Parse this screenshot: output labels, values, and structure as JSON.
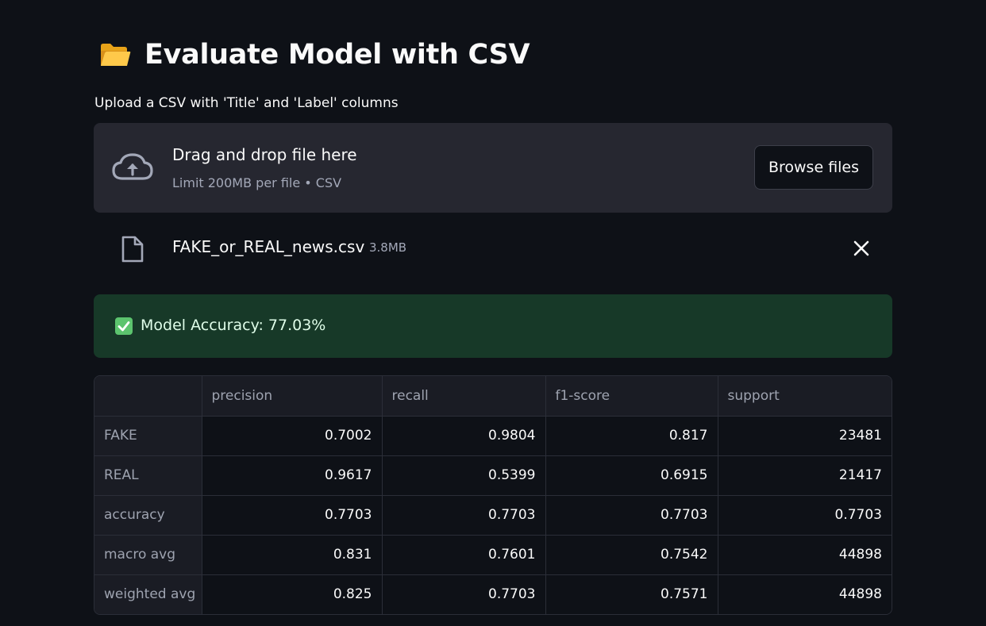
{
  "header": {
    "icon": "open-folder-icon",
    "title": "Evaluate Model with CSV"
  },
  "uploader": {
    "label": "Upload a CSV with 'Title' and 'Label' columns",
    "icon": "cloud-upload-icon",
    "drop_title": "Drag and drop file here",
    "drop_subtitle": "Limit 200MB per file • CSV",
    "browse_label": "Browse files"
  },
  "uploaded_file": {
    "icon": "file-icon",
    "name": "FAKE_or_REAL_news.csv",
    "size": "3.8MB",
    "remove_icon": "close-icon"
  },
  "result": {
    "icon": "check-mark-icon",
    "message": "Model Accuracy: 77.03%",
    "color": "#173928"
  },
  "report": {
    "columns": [
      "",
      "precision",
      "recall",
      "f1-score",
      "support"
    ],
    "rows": [
      {
        "label": "FAKE",
        "precision": "0.7002",
        "recall": "0.9804",
        "f1": "0.817",
        "support": "23481"
      },
      {
        "label": "REAL",
        "precision": "0.9617",
        "recall": "0.5399",
        "f1": "0.6915",
        "support": "21417"
      },
      {
        "label": "accuracy",
        "precision": "0.7703",
        "recall": "0.7703",
        "f1": "0.7703",
        "support": "0.7703"
      },
      {
        "label": "macro avg",
        "precision": "0.831",
        "recall": "0.7601",
        "f1": "0.7542",
        "support": "44898"
      },
      {
        "label": "weighted avg",
        "precision": "0.825",
        "recall": "0.7703",
        "f1": "0.7571",
        "support": "44898"
      }
    ]
  }
}
